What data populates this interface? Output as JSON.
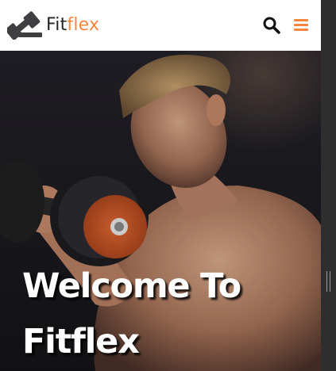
{
  "brand": {
    "part1": "Fit",
    "part2": "flex"
  },
  "nav": {
    "search_icon": "search-icon",
    "menu_icon": "hamburger-menu-icon"
  },
  "hero": {
    "title_line1": "Welcome To",
    "title_line2": "Fitflex"
  },
  "colors": {
    "accent": "#f7863f",
    "logo_dark": "#3f3f41",
    "text_dark": "#252525"
  }
}
